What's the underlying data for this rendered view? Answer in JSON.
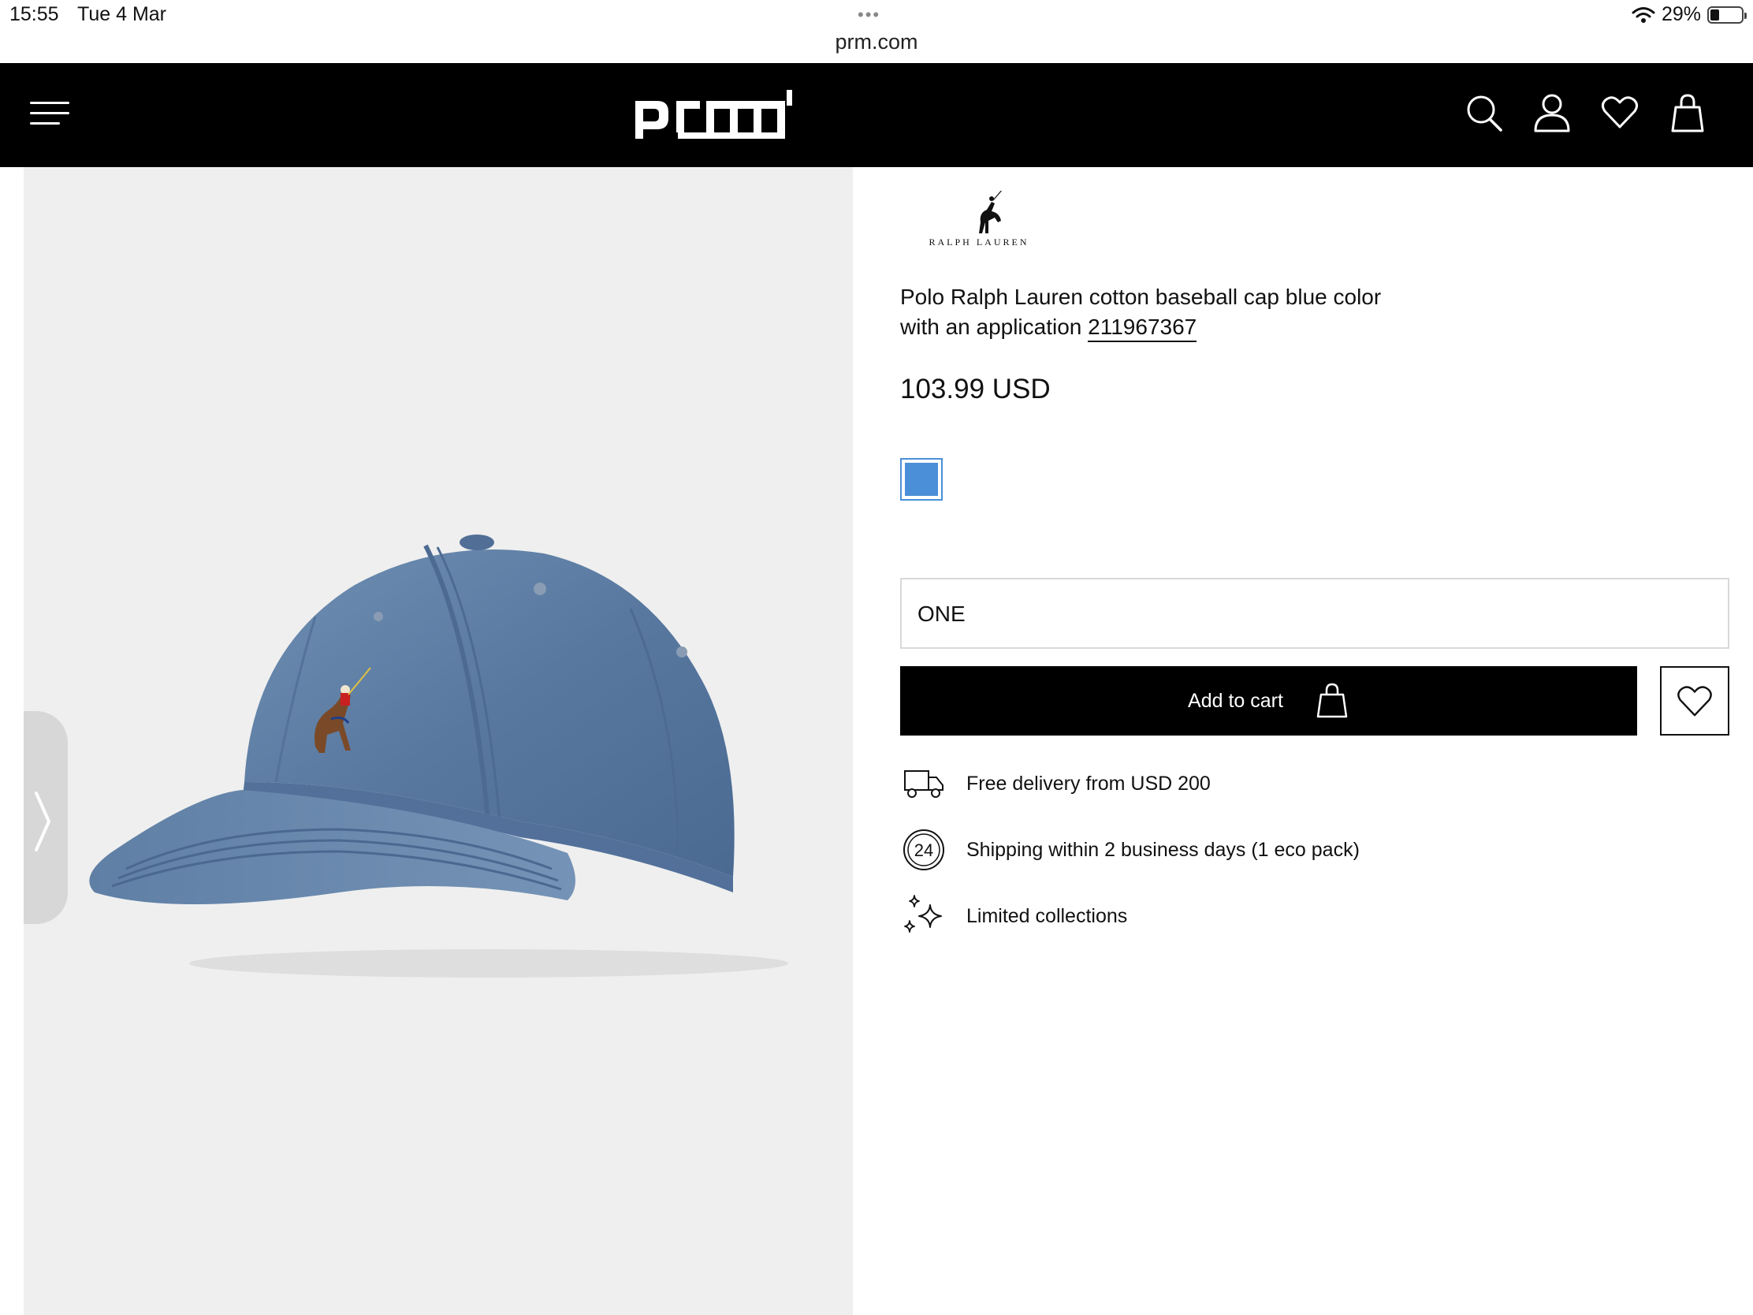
{
  "status_bar": {
    "time": "15:55",
    "date": "Tue 4 Mar",
    "dots": "•••",
    "url": "prm.com",
    "battery": "29%",
    "battery_level": 0.29
  },
  "header": {
    "logo": "prm"
  },
  "brand": {
    "name": "RALPH LAUREN"
  },
  "product": {
    "title": "Polo Ralph Lauren cotton baseball cap blue color with an application",
    "sku": "211967367",
    "price": "103.99 USD",
    "color": "#4a8fd8",
    "size": "ONE",
    "add_to_cart": "Add to cart"
  },
  "features": [
    {
      "icon": "truck-icon",
      "text": "Free delivery from USD 200"
    },
    {
      "icon": "24-hours-icon",
      "text": "Shipping within 2 business days (1 eco pack)"
    },
    {
      "icon": "sparkles-icon",
      "text": "Limited collections"
    }
  ]
}
